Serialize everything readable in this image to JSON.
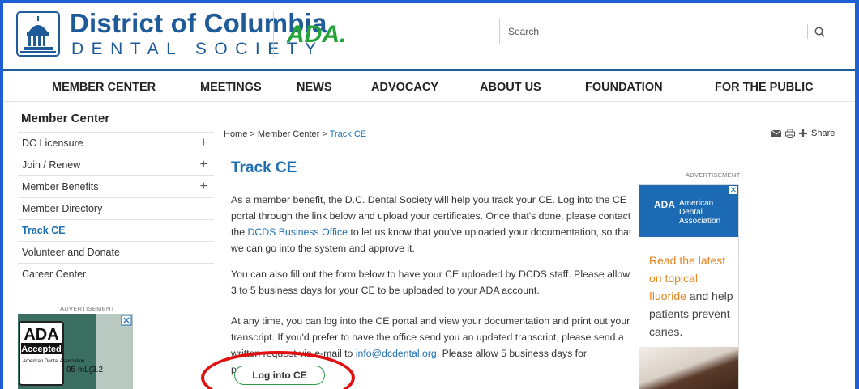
{
  "header": {
    "logo_line1": "District of Columbia",
    "logo_line2": "DENTAL SOCIETY",
    "ada_logo": "ADA.",
    "search_placeholder": "Search",
    "search_icon": "search-icon"
  },
  "nav": {
    "items": [
      "MEMBER CENTER",
      "MEETINGS",
      "NEWS",
      "ADVOCACY",
      "ABOUT US",
      "FOUNDATION",
      "FOR THE PUBLIC"
    ]
  },
  "sidebar": {
    "title": "Member Center",
    "items": [
      {
        "label": "DC Licensure",
        "expand": "+"
      },
      {
        "label": "Join / Renew",
        "expand": "+"
      },
      {
        "label": "Member Benefits",
        "expand": "+"
      },
      {
        "label": "Member Directory"
      },
      {
        "label": "Track CE",
        "active": true
      },
      {
        "label": "Volunteer and Donate"
      },
      {
        "label": "Career Center"
      }
    ],
    "ad_label": "ADVERTISEMENT",
    "ad_text": {
      "ada": "ADA",
      "accepted": "Accepted",
      "assoc": "American Dental Association",
      "volume": "95 mL(3.2"
    }
  },
  "breadcrumb": {
    "home": "Home",
    "sep": ">",
    "member_center": "Member Center",
    "current": "Track CE"
  },
  "tools": {
    "share_label": "Share"
  },
  "main": {
    "title": "Track CE",
    "para1_a": "As a member benefit, the D.C. Dental Society will help you track your CE. Log into the CE portal through the link below and upload your certificates. Once that's done, please contact the ",
    "para1_link": "DCDS Business Office",
    "para1_b": " to let us know that you've uploaded your documentation, so that we can go into the system and approve it.",
    "para2": "You can also fill out the form below to have your CE uploaded by DCDS staff.  Please allow 3 to 5 business days for your CE to be uploaded to your ADA account.",
    "para3_a": "At any time, you can log into the CE portal and view your documentation and print out your transcript. If you'd prefer to have the office send you an updated transcript, please send a written request via e-mail to ",
    "para3_link": "info@dcdental.org",
    "para3_b": ". Please allow 5 business days for processing.",
    "login_button": "Log into CE"
  },
  "right_ad": {
    "label": "ADVERTISEMENT",
    "ada": "ADA",
    "org_line1": "American",
    "org_line2": "Dental",
    "org_line3": "Association",
    "close": "✕",
    "text_hl": "Read the latest on topical fluoride",
    "text_rest": " and help patients prevent caries."
  },
  "colors": {
    "brand": "#1e5b98",
    "link": "#1e6fb3",
    "ada_green": "#23a23a",
    "highlight": "#e01010"
  }
}
